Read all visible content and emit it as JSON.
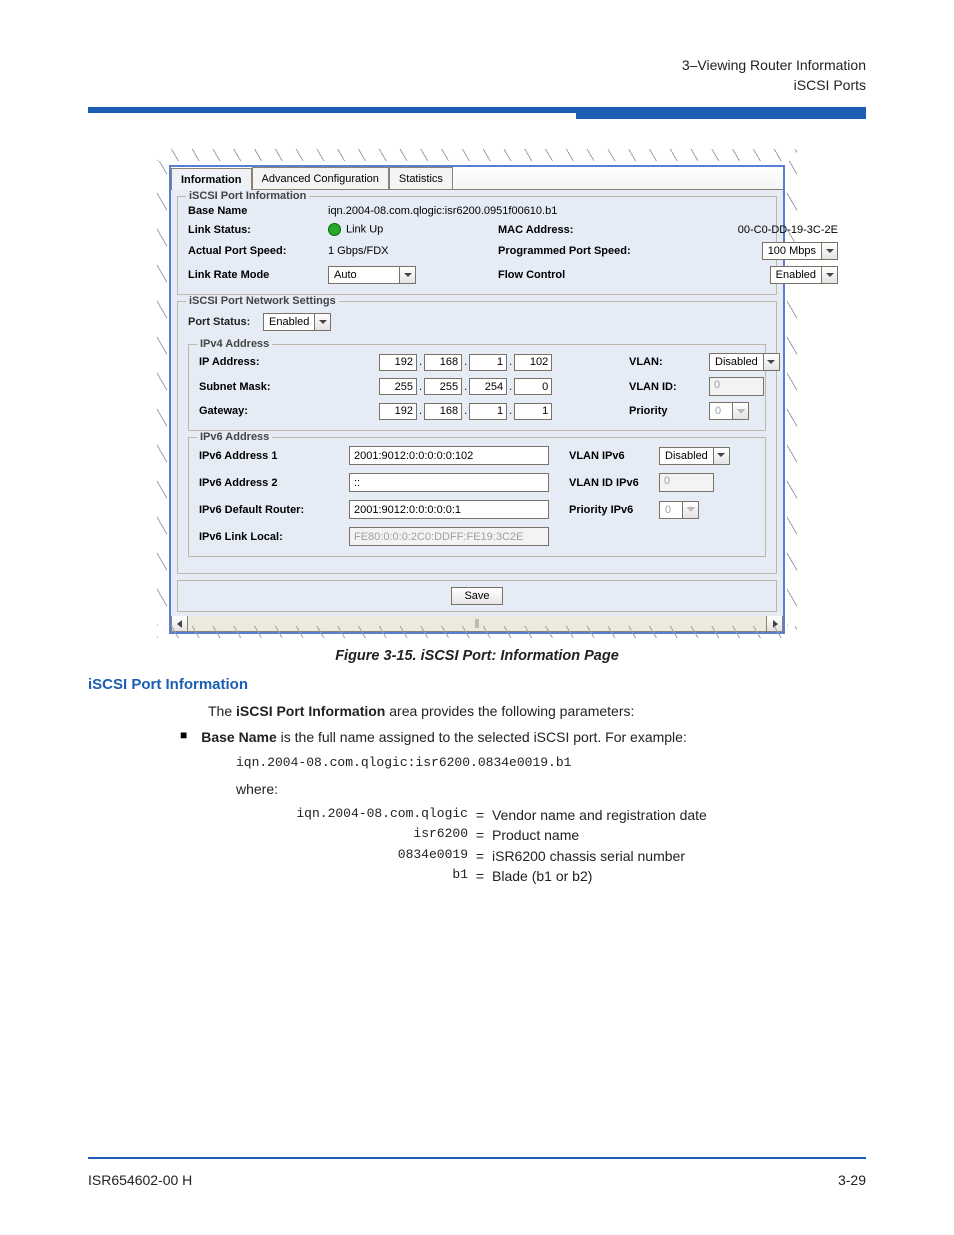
{
  "header": {
    "line1": "3–Viewing Router Information",
    "line2": "iSCSI Ports"
  },
  "figure": {
    "tabs": [
      "Information",
      "Advanced Configuration",
      "Statistics"
    ],
    "selected_tab": 0,
    "port_info": {
      "legend": "iSCSI Port Information",
      "base_name_label": "Base Name",
      "base_name_value": "iqn.2004-08.com.qlogic:isr6200.0951f00610.b1",
      "link_status_label": "Link Status:",
      "link_status_value": "Link Up",
      "mac_label": "MAC Address:",
      "mac_value": "00-C0-DD-19-3C-2E",
      "actual_speed_label": "Actual Port Speed:",
      "actual_speed_value": "1 Gbps/FDX",
      "prog_speed_label": "Programmed Port Speed:",
      "prog_speed_value": "100 Mbps",
      "link_rate_label": "Link Rate Mode",
      "link_rate_value": "Auto",
      "flow_label": "Flow Control",
      "flow_value": "Enabled"
    },
    "net": {
      "legend": "iSCSI Port Network Settings",
      "port_status_label": "Port Status:",
      "port_status_value": "Enabled",
      "ipv4": {
        "legend": "IPv4 Address",
        "ip_label": "IP Address:",
        "ip": [
          "192",
          "168",
          "1",
          "102"
        ],
        "sm_label": "Subnet Mask:",
        "sm": [
          "255",
          "255",
          "254",
          "0"
        ],
        "gw_label": "Gateway:",
        "gw": [
          "192",
          "168",
          "1",
          "1"
        ],
        "vlan_label": "VLAN:",
        "vlan_value": "Disabled",
        "vlan_id_label": "VLAN ID:",
        "vlan_id_value": "0",
        "prio_label": "Priority",
        "prio_value": "0"
      },
      "ipv6": {
        "legend": "IPv6 Address",
        "a1_label": "IPv6 Address 1",
        "a1_value": "2001:9012:0:0:0:0:0:102",
        "a2_label": "IPv6 Address 2",
        "a2_value": "::",
        "def_label": "IPv6 Default Router:",
        "def_value": "2001:9012:0:0:0:0:0:1",
        "ll_label": "IPv6 Link Local:",
        "ll_value": "FE80:0:0:0:2C0:DDFF:FE19:3C2E",
        "vlan6_label": "VLAN IPv6",
        "vlan6_value": "Disabled",
        "vlan6id_label": "VLAN ID IPv6",
        "vlan6id_value": "0",
        "prio6_label": "Priority IPv6",
        "prio6_value": "0"
      }
    },
    "save_label": "Save"
  },
  "caption": "Figure 3-15. iSCSI Port: Information Page",
  "section_heading": "iSCSI Port Information",
  "body": {
    "intro_pre": "The ",
    "intro_strong": "iSCSI Port Information",
    "intro_post": " area provides the following parameters:",
    "bullet_strong": "Base Name",
    "bullet_rest": " is the full name assigned to the selected iSCSI port. For example:",
    "example": "iqn.2004-08.com.qlogic:isr6200.0834e0019.b1",
    "where": "where:",
    "defs": [
      {
        "k": "iqn.2004-08.com.qlogic",
        "v": "Vendor name and registration date"
      },
      {
        "k": "isr6200",
        "v": "Product name"
      },
      {
        "k": "0834e0019",
        "v": "iSR6200 chassis serial number"
      },
      {
        "k": "b1",
        "v": "Blade (b1 or b2)"
      }
    ]
  },
  "footer": {
    "left": "ISR654602-00  H",
    "right": "3-29"
  }
}
